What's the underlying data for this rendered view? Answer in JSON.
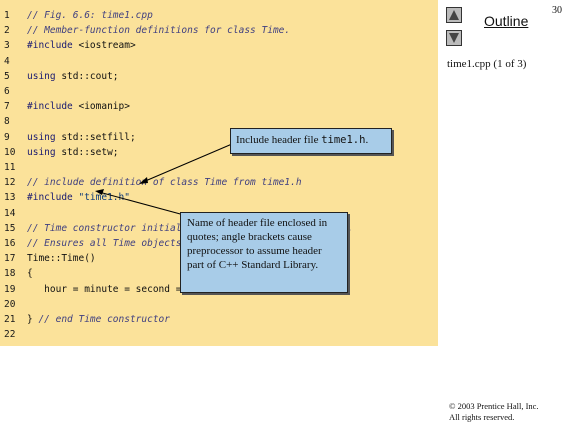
{
  "slide": {
    "number": "30"
  },
  "nav": {
    "outline_label": "Outline",
    "file_label": "time1.cpp (1 of 3)"
  },
  "code": {
    "lines": [
      {
        "n": "1",
        "parts": [
          [
            "cm",
            "// Fig. 6.6: time1.cpp"
          ]
        ]
      },
      {
        "n": "2",
        "parts": [
          [
            "cm",
            "// Member-function definitions for class Time."
          ]
        ]
      },
      {
        "n": "3",
        "parts": [
          [
            "kw",
            "#include"
          ],
          [
            "pl",
            " <iostream>"
          ]
        ]
      },
      {
        "n": "4",
        "parts": []
      },
      {
        "n": "5",
        "parts": [
          [
            "kw",
            "using"
          ],
          [
            "pl",
            " std::cout;"
          ]
        ]
      },
      {
        "n": "6",
        "parts": []
      },
      {
        "n": "7",
        "parts": [
          [
            "kw",
            "#include"
          ],
          [
            "pl",
            " <iomanip>"
          ]
        ]
      },
      {
        "n": "8",
        "parts": []
      },
      {
        "n": "9",
        "parts": [
          [
            "kw",
            "using"
          ],
          [
            "pl",
            " std::setfill;"
          ]
        ]
      },
      {
        "n": "10",
        "parts": [
          [
            "kw",
            "using"
          ],
          [
            "pl",
            " std::setw;"
          ]
        ]
      },
      {
        "n": "11",
        "parts": []
      },
      {
        "n": "12",
        "parts": [
          [
            "cm",
            "// include definition of class Time from time1.h"
          ]
        ]
      },
      {
        "n": "13",
        "parts": [
          [
            "kw",
            "#include"
          ],
          [
            "st",
            " \"time1.h\""
          ]
        ]
      },
      {
        "n": "14",
        "parts": []
      },
      {
        "n": "15",
        "parts": [
          [
            "cm",
            "// Time constructor initializes each data member to zero."
          ]
        ]
      },
      {
        "n": "16",
        "parts": [
          [
            "cm",
            "// Ensures all Time objects start in a consistent state."
          ]
        ]
      },
      {
        "n": "17",
        "parts": [
          [
            "pl",
            "Time::Time()"
          ]
        ]
      },
      {
        "n": "18",
        "parts": [
          [
            "pl",
            "{"
          ]
        ]
      },
      {
        "n": "19",
        "parts": [
          [
            "pl",
            "   hour = minute = second = 0;"
          ]
        ]
      },
      {
        "n": "20",
        "parts": []
      },
      {
        "n": "21",
        "parts": [
          [
            "pl",
            "} "
          ],
          [
            "cm",
            "// end Time constructor"
          ]
        ]
      },
      {
        "n": "22",
        "parts": []
      }
    ]
  },
  "callouts": {
    "header": {
      "prefix": "Include header file ",
      "code": "time1.h",
      "suffix": "."
    },
    "quotes": {
      "text": "Name of header file enclosed in quotes; angle brackets cause preprocessor to assume header part of C++ Standard Library."
    }
  },
  "footer": {
    "line1": "© 2003 Prentice Hall, Inc.",
    "line2": "All rights reserved."
  },
  "colors": {
    "code_bg": "#fbe29a",
    "callout_bg": "#a8cce8"
  }
}
